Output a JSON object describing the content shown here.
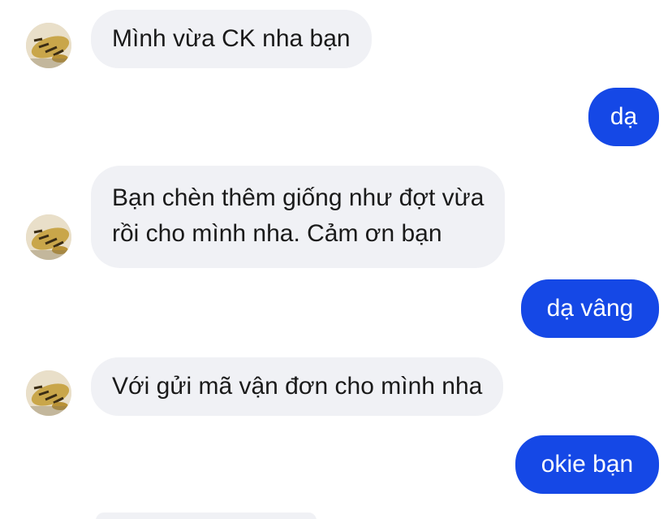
{
  "messages": [
    {
      "side": "incoming",
      "text": "Mình vừa CK nha bạn"
    },
    {
      "side": "outgoing",
      "text": "dạ"
    },
    {
      "side": "incoming",
      "line1": "Bạn chèn thêm giống như đợt vừa",
      "line2": "rồi cho mình nha. Cảm ơn bạn"
    },
    {
      "side": "outgoing",
      "text": "dạ vâng"
    },
    {
      "side": "incoming",
      "text": "Với gửi mã vận đơn cho mình nha"
    },
    {
      "side": "outgoing",
      "text": "okie bạn"
    }
  ],
  "colors": {
    "incoming_bubble": "#f0f1f5",
    "outgoing_bubble": "#1548e6",
    "outgoing_text": "#ffffff",
    "incoming_text": "#1a1a1a"
  },
  "avatar_icon": "fish-photo-avatar"
}
